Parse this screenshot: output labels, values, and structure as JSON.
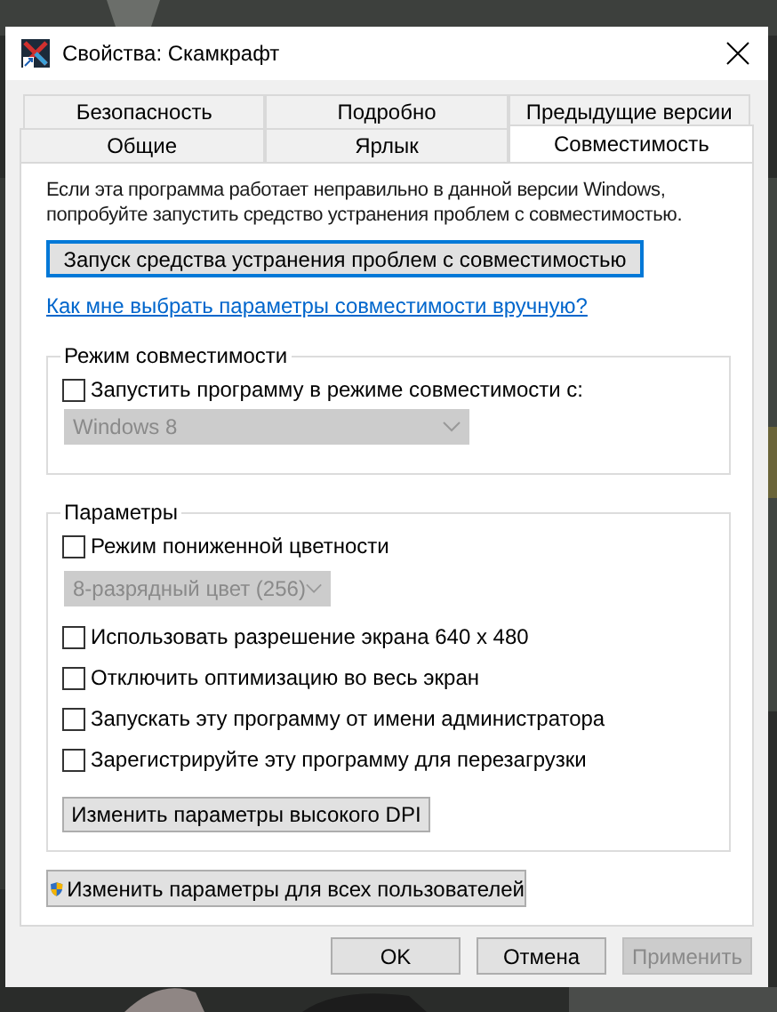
{
  "window": {
    "title": "Свойства: Скамкрафт"
  },
  "tab_rows": [
    [
      {
        "label": "Безопасность",
        "selected": false
      },
      {
        "label": "Подробно",
        "selected": false
      },
      {
        "label": "Предыдущие версии",
        "selected": false
      }
    ],
    [
      {
        "label": "Общие",
        "selected": false
      },
      {
        "label": "Ярлык",
        "selected": false
      },
      {
        "label": "Совместимость",
        "selected": true
      }
    ]
  ],
  "intro": "Если эта программа работает неправильно в данной версии Windows, попробуйте запустить средство устранения проблем с совместимостью.",
  "troubleshoot_button": {
    "label": "Запуск средства устранения проблем с совместимостью"
  },
  "help_link": "Как мне выбрать параметры совместимости вручную?",
  "compat_group": {
    "title": "Режим совместимости",
    "items": [
      {
        "kind": "checkbox",
        "label": "Запустить программу в режиме совместимости с:",
        "checked": false
      },
      {
        "kind": "dropdown",
        "value": "Windows 8",
        "disabled": true
      }
    ]
  },
  "settings_group": {
    "title": "Параметры",
    "items": [
      {
        "kind": "checkbox",
        "label": "Режим пониженной цветности",
        "checked": false
      },
      {
        "kind": "dropdown",
        "value": "8-разрядный цвет (256)",
        "disabled": true
      },
      {
        "kind": "checkbox",
        "label": "Использовать разрешение экрана 640 x 480",
        "checked": false
      },
      {
        "kind": "checkbox",
        "label": "Отключить оптимизацию во весь экран",
        "checked": false
      },
      {
        "kind": "checkbox",
        "label": "Запускать эту программу от имени администратора",
        "checked": false
      },
      {
        "kind": "checkbox",
        "label": "Зарегистрируйте эту программу для перезагрузки",
        "checked": false
      },
      {
        "kind": "button",
        "label": "Изменить параметры высокого DPI"
      }
    ]
  },
  "all_users_button": {
    "label": "Изменить параметры для всех пользователей"
  },
  "footer_buttons": [
    {
      "label": "OK",
      "disabled": false
    },
    {
      "label": "Отмена",
      "disabled": false
    },
    {
      "label": "Применить",
      "disabled": true
    }
  ]
}
